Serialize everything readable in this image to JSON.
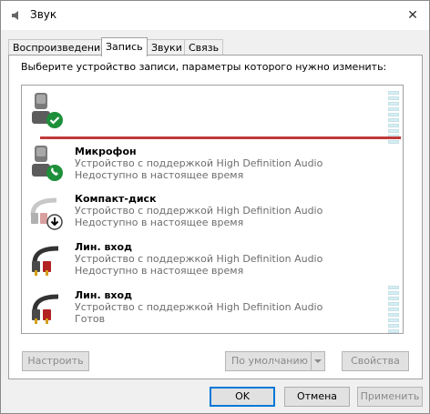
{
  "window": {
    "title": "Звук",
    "close_glyph": "✕"
  },
  "tabs": [
    {
      "label": "Воспроизведение"
    },
    {
      "label": "Запись"
    },
    {
      "label": "Звуки"
    },
    {
      "label": "Связь"
    }
  ],
  "active_tab": "Запись",
  "instruction": "Выберите устройство записи, параметры которого нужно изменить:",
  "devices": [
    {
      "name": "",
      "description": "",
      "status": "",
      "icon": "microphone-default-icon",
      "selected": true
    },
    {
      "name": "Микрофон",
      "description": "Устройство с поддержкой High Definition Audio",
      "status": "Недоступно в настоящее время",
      "icon": "microphone-comm-icon"
    },
    {
      "name": "Компакт-диск",
      "description": "Устройство с поддержкой High Definition Audio",
      "status": "Недоступно в настоящее время",
      "icon": "cd-audio-cable-icon"
    },
    {
      "name": "Лин. вход",
      "description": "Устройство с поддержкой High Definition Audio",
      "status": "Недоступно в настоящее время",
      "icon": "line-in-cable-icon"
    },
    {
      "name": "Лин. вход",
      "description": "Устройство с поддержкой High Definition Audio",
      "status": "Готов",
      "icon": "line-in-cable-icon"
    }
  ],
  "buttons": {
    "configure": "Настроить",
    "set_default": "По умолчанию",
    "properties": "Свойства",
    "ok": "OK",
    "cancel": "Отмена",
    "apply": "Применить"
  },
  "colors": {
    "accent": "#0078d7",
    "ok_badge": "#1e8f3a",
    "selection_line": "#c13a3a"
  }
}
